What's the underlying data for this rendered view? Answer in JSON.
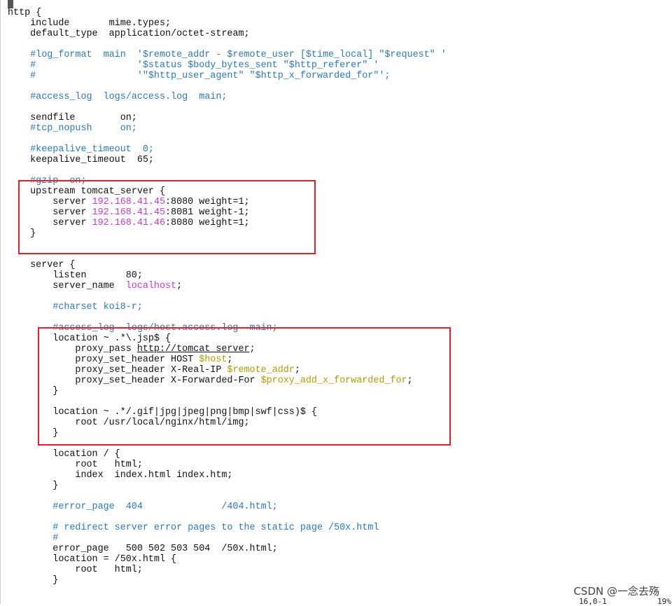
{
  "lines": [
    [
      {
        "t": "http {"
      }
    ],
    [
      {
        "t": "    include       mime.types;"
      }
    ],
    [
      {
        "t": "    default_type  application/octet-stream;"
      }
    ],
    [
      {
        "t": ""
      }
    ],
    [
      {
        "t": "    #log_format  main  '$remote_addr - $remote_user [$time_local] \"$request\" '",
        "c": "cm"
      }
    ],
    [
      {
        "t": "    #                  '$status $body_bytes_sent \"$http_referer\" '",
        "c": "cm"
      }
    ],
    [
      {
        "t": "    #                  '\"$http_user_agent\" \"$http_x_forwarded_for\"';",
        "c": "cm"
      }
    ],
    [
      {
        "t": ""
      }
    ],
    [
      {
        "t": "    #access_log  logs/access.log  main;",
        "c": "cm"
      }
    ],
    [
      {
        "t": ""
      }
    ],
    [
      {
        "t": "    sendfile        on;"
      }
    ],
    [
      {
        "t": "    #tcp_nopush     on;",
        "c": "cm"
      }
    ],
    [
      {
        "t": ""
      }
    ],
    [
      {
        "t": "    #keepalive_timeout  0;",
        "c": "cm"
      }
    ],
    [
      {
        "t": "    keepalive_timeout  65;"
      }
    ],
    [
      {
        "t": ""
      }
    ],
    [
      {
        "t": "    #gzip  on;",
        "c": "cm"
      }
    ],
    [
      {
        "t": "    upstream tomcat_server {"
      }
    ],
    [
      {
        "t": "        server "
      },
      {
        "t": "192.168.41.45",
        "c": "ip"
      },
      {
        "t": ":8080 weight=1;"
      }
    ],
    [
      {
        "t": "        server "
      },
      {
        "t": "192.168.41.45",
        "c": "ip"
      },
      {
        "t": ":8081 weight-1;"
      }
    ],
    [
      {
        "t": "        server "
      },
      {
        "t": "192.168.41.46",
        "c": "ip"
      },
      {
        "t": ":8080 weight=1;"
      }
    ],
    [
      {
        "t": "    }"
      }
    ],
    [
      {
        "t": ""
      }
    ],
    [
      {
        "t": ""
      }
    ],
    [
      {
        "t": "    server {"
      }
    ],
    [
      {
        "t": "        listen       80;"
      }
    ],
    [
      {
        "t": "        server_name  "
      },
      {
        "t": "localhost",
        "c": "ip"
      },
      {
        "t": ";"
      }
    ],
    [
      {
        "t": ""
      }
    ],
    [
      {
        "t": "        #charset koi8-r;",
        "c": "cm"
      }
    ],
    [
      {
        "t": ""
      }
    ],
    [
      {
        "t": "        #access_log  logs/host.access.log  main;",
        "c": "cm"
      }
    ],
    [
      {
        "t": "        location ~ .*\\.jsp$ {"
      }
    ],
    [
      {
        "t": "            proxy_pass "
      },
      {
        "t": "http://tomcat_server",
        "c": "lk"
      },
      {
        "t": ";"
      }
    ],
    [
      {
        "t": "            proxy_set_header HOST "
      },
      {
        "t": "$host",
        "c": "vr"
      },
      {
        "t": ";"
      }
    ],
    [
      {
        "t": "            proxy_set_header X-Real-IP "
      },
      {
        "t": "$remote_addr",
        "c": "vr"
      },
      {
        "t": ";"
      }
    ],
    [
      {
        "t": "            proxy_set_header X-Forwarded-For "
      },
      {
        "t": "$proxy_add_x_forwarded_for",
        "c": "vr"
      },
      {
        "t": ";"
      }
    ],
    [
      {
        "t": "        }"
      }
    ],
    [
      {
        "t": ""
      }
    ],
    [
      {
        "t": "        location ~ .*/.gif|jpg|jpeg|png|bmp|swf|css)$ {"
      }
    ],
    [
      {
        "t": "            root /usr/local/nginx/html/img;"
      }
    ],
    [
      {
        "t": "        }"
      }
    ],
    [
      {
        "t": ""
      }
    ],
    [
      {
        "t": "        location / {"
      }
    ],
    [
      {
        "t": "            root   html;"
      }
    ],
    [
      {
        "t": "            index  index.html index.htm;"
      }
    ],
    [
      {
        "t": "        }"
      }
    ],
    [
      {
        "t": ""
      }
    ],
    [
      {
        "t": "        #error_page  404              /404.html;",
        "c": "cm"
      }
    ],
    [
      {
        "t": ""
      }
    ],
    [
      {
        "t": "        # redirect server error pages to the static page /50x.html",
        "c": "cm"
      }
    ],
    [
      {
        "t": "        #",
        "c": "cm"
      }
    ],
    [
      {
        "t": "        error_page   500 502 503 504  /50x.html;"
      }
    ],
    [
      {
        "t": "        location = /50x.html {"
      }
    ],
    [
      {
        "t": "            root   html;"
      }
    ],
    [
      {
        "t": "        }"
      }
    ]
  ],
  "watermark": "CSDN @一念去殇",
  "status": {
    "position": "16,0-1",
    "percent": "19%"
  },
  "colors": {
    "comment": "#2a7ab8",
    "ip": "#c63ad1",
    "variable": "#b39a00",
    "highlight_box": "#e0202a"
  }
}
